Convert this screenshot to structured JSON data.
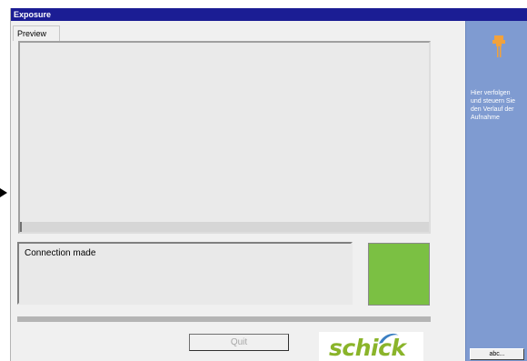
{
  "window": {
    "title": "Exposure"
  },
  "tabs": [
    {
      "label": "Preview"
    }
  ],
  "status": {
    "message": "Connection made",
    "indicator_color": "#7bc043"
  },
  "buttons": {
    "quit_label": "Quit",
    "abc_label": "abc..."
  },
  "logo": {
    "text": "schick",
    "color": "#8ab42a"
  },
  "side_panel": {
    "icon": "exposure-tool-icon",
    "help_text": "Hier verfolgen\nund steuern Sie\nden Verlauf der\nAufnahme"
  },
  "colors": {
    "title_bar": "#1b1d94",
    "side_panel": "#7f9bd1",
    "icon_accent": "#f2a23c"
  }
}
